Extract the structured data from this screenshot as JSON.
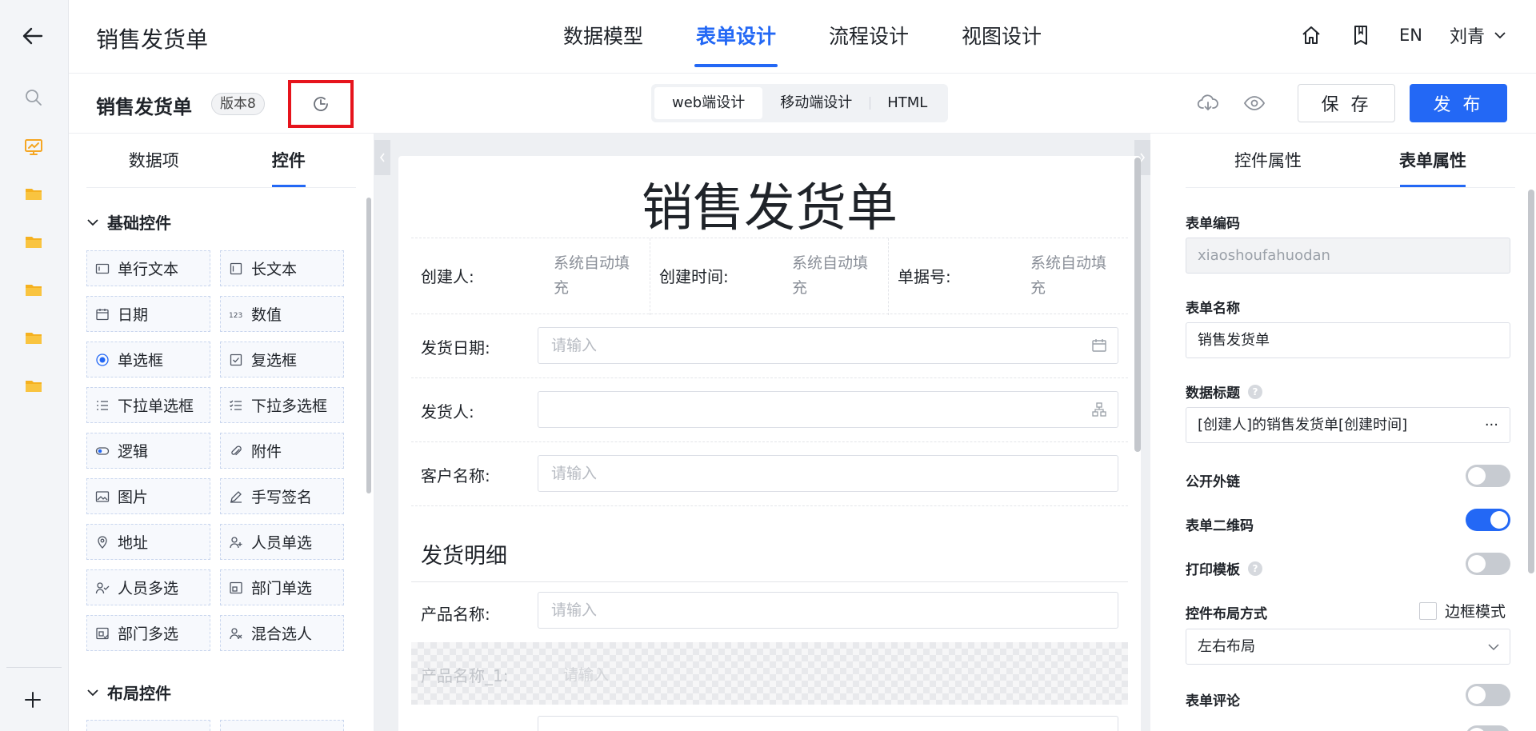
{
  "header": {
    "app_title": "销售发货单",
    "tabs": [
      {
        "label": "数据模型",
        "active": false
      },
      {
        "label": "表单设计",
        "active": true
      },
      {
        "label": "流程设计",
        "active": false
      },
      {
        "label": "视图设计",
        "active": false
      }
    ],
    "lang": "EN",
    "user": "刘青"
  },
  "toolbar": {
    "form_name": "销售发货单",
    "version": "版本8",
    "modes": [
      "web端设计",
      "移动端设计",
      "HTML"
    ],
    "save_label": "保 存",
    "publish_label": "发 布"
  },
  "left_panel": {
    "tabs": [
      "数据项",
      "控件"
    ],
    "section_basic": "基础控件",
    "section_layout": "布局控件",
    "controls": [
      {
        "label": "单行文本",
        "icon": "single-line-text-icon"
      },
      {
        "label": "长文本",
        "icon": "long-text-icon"
      },
      {
        "label": "日期",
        "icon": "calendar-icon"
      },
      {
        "label": "数值",
        "icon": "number-icon"
      },
      {
        "label": "单选框",
        "icon": "radio-icon"
      },
      {
        "label": "复选框",
        "icon": "checkbox-icon"
      },
      {
        "label": "下拉单选框",
        "icon": "dropdown-single-icon"
      },
      {
        "label": "下拉多选框",
        "icon": "dropdown-multi-icon"
      },
      {
        "label": "逻辑",
        "icon": "toggle-icon"
      },
      {
        "label": "附件",
        "icon": "paperclip-icon"
      },
      {
        "label": "图片",
        "icon": "image-icon"
      },
      {
        "label": "手写签名",
        "icon": "pen-icon"
      },
      {
        "label": "地址",
        "icon": "location-icon"
      },
      {
        "label": "人员单选",
        "icon": "user-add-icon"
      },
      {
        "label": "人员多选",
        "icon": "users-icon"
      },
      {
        "label": "部门单选",
        "icon": "dept-icon"
      },
      {
        "label": "部门多选",
        "icon": "dept-multi-icon"
      },
      {
        "label": "混合选人",
        "icon": "user-mixed-icon"
      }
    ]
  },
  "form": {
    "title": "销售发货单",
    "meta": [
      {
        "label": "创建人:",
        "value": "系统自动填充"
      },
      {
        "label": "创建时间:",
        "value": "系统自动填充"
      },
      {
        "label": "单据号:",
        "value": "系统自动填充"
      }
    ],
    "fields": [
      {
        "label": "发货日期:",
        "placeholder": "请输入",
        "icon": "calendar-icon"
      },
      {
        "label": "发货人:",
        "placeholder": "",
        "icon": "org-tree-icon"
      },
      {
        "label": "客户名称:",
        "placeholder": "请输入"
      }
    ],
    "subtable_title": "发货明细",
    "sub_fields": [
      {
        "label": "产品名称:",
        "placeholder": "请输入"
      },
      {
        "label": "产品名称_1:",
        "placeholder": "请输入"
      }
    ]
  },
  "right_panel": {
    "tabs": [
      "控件属性",
      "表单属性"
    ],
    "form_code_label": "表单编码",
    "form_code": "xiaoshoufahuodan",
    "form_name_label": "表单名称",
    "form_name": "销售发货单",
    "data_title_label": "数据标题",
    "data_title": "[创建人]的销售发货单[创建时间]",
    "public_link_label": "公开外链",
    "public_link": false,
    "qrcode_label": "表单二维码",
    "qrcode": true,
    "print_label": "打印模板",
    "print": false,
    "layout_label": "控件布局方式",
    "border_mode_label": "边框模式",
    "layout_value": "左右布局",
    "comment_label": "表单评论",
    "comment": false
  }
}
